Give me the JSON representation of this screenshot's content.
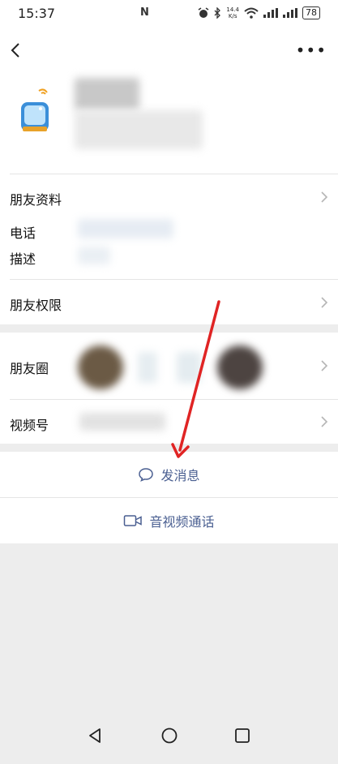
{
  "status_bar": {
    "time": "15:37",
    "network_speed_value": "14.4",
    "network_speed_unit": "K/s",
    "battery": "78",
    "icons": [
      "nfc-icon",
      "alarm-icon",
      "bluetooth-icon",
      "wifi-icon",
      "signal-icon",
      "signal-icon",
      "battery-icon"
    ]
  },
  "header": {
    "back_icon": "chevron-left-icon",
    "more_label": "•••"
  },
  "profile": {
    "avatar_icon": "smartwatch-avatar-icon"
  },
  "rows": {
    "friend_info": "朋友资料",
    "phone": "电话",
    "description": "描述",
    "permissions": "朋友权限",
    "moments": "朋友圈",
    "channels": "视频号"
  },
  "actions": {
    "send_message": "发消息",
    "video_call": "音视频通话"
  },
  "colors": {
    "accent": "#4a5f91",
    "annotation_arrow": "#e02424",
    "background": "#ededed"
  }
}
